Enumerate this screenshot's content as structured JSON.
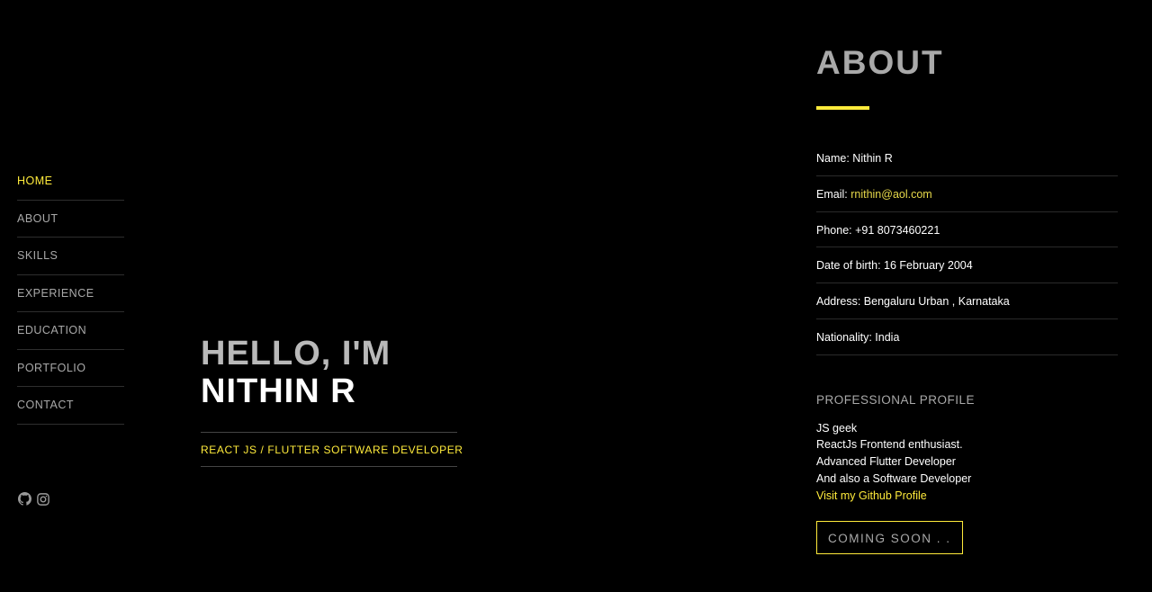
{
  "nav": {
    "items": [
      {
        "label": "HOME",
        "active": true
      },
      {
        "label": "ABOUT"
      },
      {
        "label": "SKILLS"
      },
      {
        "label": "EXPERIENCE"
      },
      {
        "label": "EDUCATION"
      },
      {
        "label": "PORTFOLIO"
      },
      {
        "label": "CONTACT"
      }
    ]
  },
  "social": {
    "icons": [
      "github-icon",
      "instagram-icon"
    ]
  },
  "hero": {
    "greeting": "HELLO, I'M",
    "name": "NITHIN R",
    "role": "REACT JS / FLUTTER SOFTWARE DEVELOPER"
  },
  "about": {
    "title": "ABOUT",
    "name_label": "Name: Nithin R",
    "email_label": "Email:",
    "email_value": "rnithin@aol.com",
    "phone": "Phone: +91 8073460221",
    "dob": "Date of birth: 16 February 2004",
    "address": "Address: Bengaluru Urban , Karnataka",
    "nationality": "Nationality: India"
  },
  "profile": {
    "title": "PROFESSIONAL PROFILE",
    "lines": [
      "JS geek",
      "ReactJs Frontend enthusiast.",
      "Advanced Flutter Developer",
      "And also a Software Developer"
    ],
    "link": "Visit my Github Profile",
    "button": "COMING SOON . ."
  },
  "colors": {
    "accent": "#ffeb3b",
    "background": "#000000",
    "muted": "#a9a9a9"
  }
}
